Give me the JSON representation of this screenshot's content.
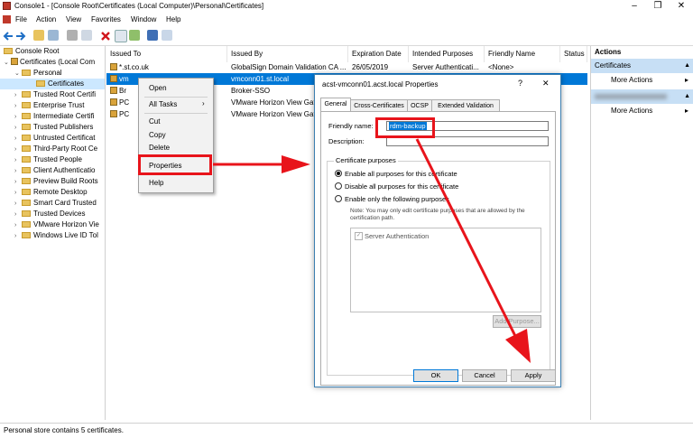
{
  "window": {
    "title": "Console1 - [Console Root\\Certificates (Local Computer)\\Personal\\Certificates]",
    "minimize": "–",
    "restore": "❐",
    "close": "✕"
  },
  "menu": [
    "File",
    "Action",
    "View",
    "Favorites",
    "Window",
    "Help"
  ],
  "tree": {
    "root": "Console Root",
    "store": "Certificates (Local Com",
    "personal": "Personal",
    "certificates": "Certificates",
    "children": [
      "Trusted Root Certifi",
      "Enterprise Trust",
      "Intermediate Certifi",
      "Trusted Publishers",
      "Untrusted Certificat",
      "Third-Party Root Ce",
      "Trusted People",
      "Client Authenticatio",
      "Preview Build Roots",
      "Remote Desktop",
      "Smart Card Trusted",
      "Trusted Devices",
      "VMware Horizon Vie",
      "Windows Live ID Tol"
    ]
  },
  "list": {
    "columns": [
      "Issued To",
      "Issued By",
      "Expiration Date",
      "Intended Purposes",
      "Friendly Name",
      "Status"
    ],
    "rows": [
      {
        "issued_to": "*.st.co.uk",
        "issued_by": "GlobalSign Domain Validation CA ...",
        "expiration": "26/05/2019",
        "purposes": "Server Authenticati...",
        "friendly": "<None>"
      },
      {
        "issued_to": "vm",
        "issued_by": "vmconn01.st.local",
        "expiration": "",
        "purposes": "",
        "friendly": ""
      },
      {
        "issued_to": "Br",
        "issued_by": "Broker-SSO",
        "expiration": "",
        "purposes": "",
        "friendly": ""
      },
      {
        "issued_to": "PC",
        "issued_by": "VMware Horizon View Gat",
        "expiration": "",
        "purposes": "",
        "friendly": ""
      },
      {
        "issued_to": "PC",
        "issued_by": "VMware Horizon View Gat",
        "expiration": "",
        "purposes": "",
        "friendly": ""
      }
    ]
  },
  "context_menu": {
    "open": "Open",
    "all_tasks": "All Tasks",
    "all_tasks_arrow": "›",
    "cut": "Cut",
    "copy": "Copy",
    "delete": "Delete",
    "properties": "Properties",
    "help": "Help"
  },
  "actions": {
    "header": "Actions",
    "section1": "Certificates",
    "more1": "More Actions",
    "more2": "More Actions"
  },
  "status": "Personal store contains 5 certificates.",
  "dialog": {
    "title": "acst-vmconn01.acst.local Properties",
    "help": "?",
    "close": "✕",
    "tabs": [
      "General",
      "Cross-Certificates",
      "OCSP",
      "Extended Validation"
    ],
    "friendly_label": "Friendly name:",
    "friendly_value": "rdm-backup",
    "description_label": "Description:",
    "purposes_group": "Certificate purposes",
    "radio1": "Enable all purposes for this certificate",
    "radio2": "Disable all purposes for this certificate",
    "radio3": "Enable only the following purposes",
    "note": "Note: You may only edit certificate purposes that are allowed by the certification path.",
    "purpose_item": "Server Authentication",
    "add_purpose": "Add Purpose...",
    "ok": "OK",
    "cancel": "Cancel",
    "apply": "Apply"
  },
  "colors": {
    "annotation_red": "#e8141b",
    "selection_blue": "#0078d7",
    "actions_section": "#c7dff5"
  }
}
